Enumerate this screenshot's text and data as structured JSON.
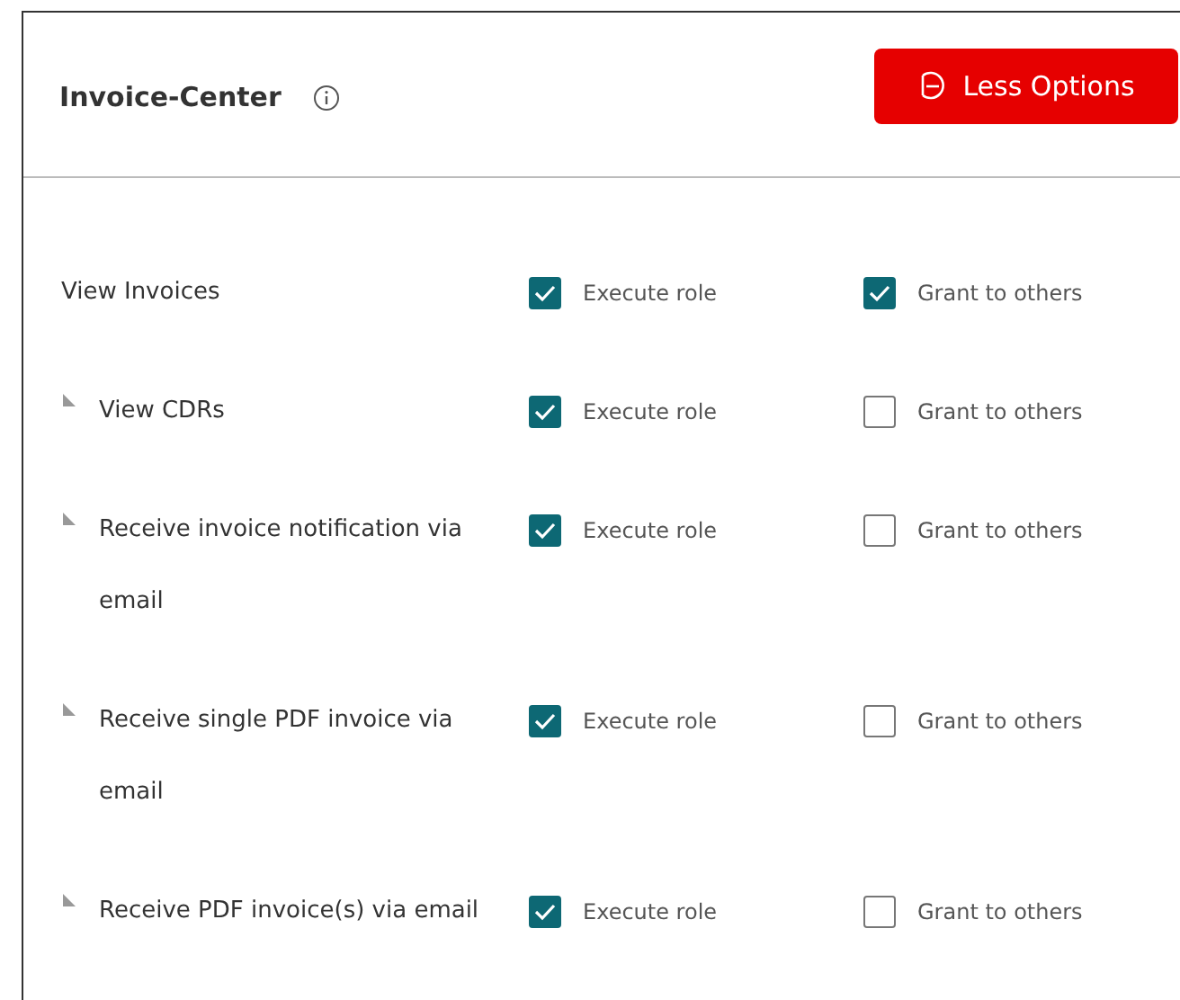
{
  "header": {
    "title": "Invoice-Center",
    "button": "Less Options"
  },
  "permissions": [
    {
      "label": "View Invoices",
      "execute": {
        "label": "Execute role",
        "checked": true
      },
      "grant": {
        "label": "Grant to others",
        "checked": true
      },
      "children": [
        {
          "label": "View CDRs",
          "execute": {
            "label": "Execute role",
            "checked": true
          },
          "grant": {
            "label": "Grant to others",
            "checked": false
          }
        },
        {
          "label": "Receive invoice notification via email",
          "execute": {
            "label": "Execute role",
            "checked": true
          },
          "grant": {
            "label": "Grant to others",
            "checked": false
          }
        },
        {
          "label": "Receive single PDF invoice via email",
          "execute": {
            "label": "Execute role",
            "checked": true
          },
          "grant": {
            "label": "Grant to others",
            "checked": false
          }
        },
        {
          "label": "Receive PDF invoice(s) via email",
          "execute": {
            "label": "Execute role",
            "checked": true
          },
          "grant": {
            "label": "Grant to others",
            "checked": false
          }
        }
      ]
    }
  ]
}
